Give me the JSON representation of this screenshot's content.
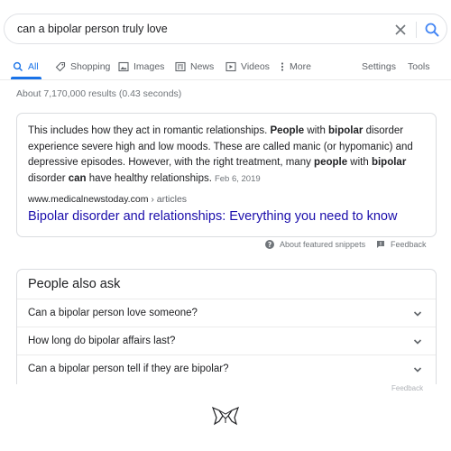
{
  "search": {
    "query": "can a bipolar person truly love",
    "icons": {
      "clear": "close-icon",
      "submit": "search-icon"
    }
  },
  "tabs": {
    "items": [
      {
        "label": "All",
        "icon": "search-icon",
        "active": true
      },
      {
        "label": "Shopping",
        "icon": "tag-icon"
      },
      {
        "label": "Images",
        "icon": "image-icon"
      },
      {
        "label": "News",
        "icon": "news-icon"
      },
      {
        "label": "Videos",
        "icon": "play-icon"
      },
      {
        "label": "More",
        "icon": "more-vertical-icon"
      }
    ],
    "settings_label": "Settings",
    "tools_label": "Tools",
    "active_color": "#1a73e8"
  },
  "results": {
    "stats": "About 7,170,000 results (0.43 seconds)"
  },
  "featured_snippet": {
    "segments": [
      {
        "text": "This includes how they act in romantic relationships. ",
        "bold": false
      },
      {
        "text": "People",
        "bold": true
      },
      {
        "text": " with ",
        "bold": false
      },
      {
        "text": "bipolar",
        "bold": true
      },
      {
        "text": " disorder experience severe high and low moods. These are called manic (or hypomanic) and depressive episodes. However, with the right treatment, many ",
        "bold": false
      },
      {
        "text": "people",
        "bold": true
      },
      {
        "text": " with ",
        "bold": false
      },
      {
        "text": "bipolar",
        "bold": true
      },
      {
        "text": " disorder ",
        "bold": false
      },
      {
        "text": "can",
        "bold": true
      },
      {
        "text": " have healthy relationships.",
        "bold": false
      }
    ],
    "date": "Feb 6, 2019",
    "cite_domain": "www.medicalnewstoday.com",
    "cite_path": " › articles",
    "link_title": "Bipolar disorder and relationships: Everything you need to know",
    "link_color": "#1a0dab"
  },
  "snippet_footer": {
    "about_label": "About featured snippets",
    "feedback_label": "Feedback"
  },
  "people_also_ask": {
    "title": "People also ask",
    "questions": [
      "Can a bipolar person love someone?",
      "How long do bipolar affairs last?",
      "Can a bipolar person tell if they are bipolar?"
    ],
    "feedback_label": "Feedback"
  },
  "logo": {
    "icon": "fox-logo-icon"
  }
}
